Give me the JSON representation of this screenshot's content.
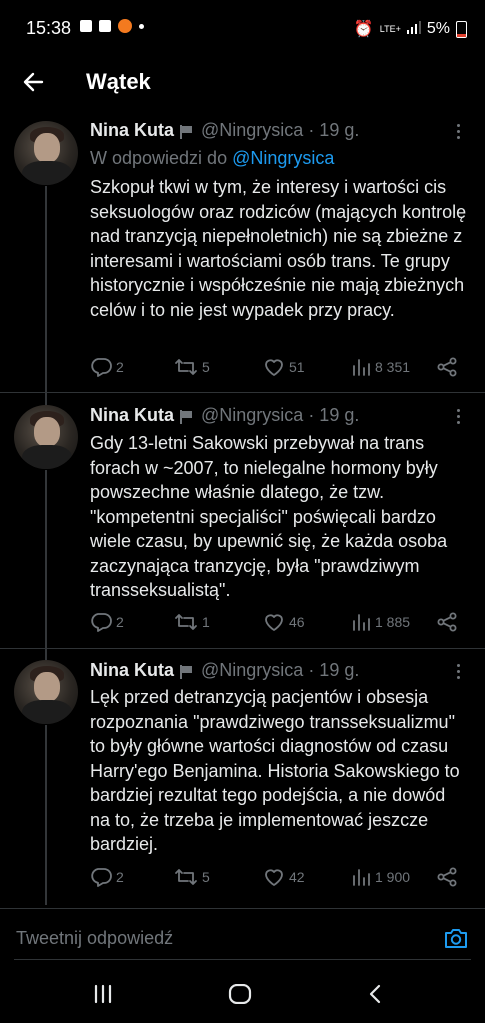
{
  "status": {
    "time": "15:38",
    "network": "LTE+",
    "battery": "5%"
  },
  "header": {
    "title": "Wątek"
  },
  "tweets": [
    {
      "name": "Nina Kuta",
      "handle": "@Ningrysica · 19 g.",
      "reply_prefix": "W odpowiedzi do",
      "reply_mention": "@Ningrysica",
      "text": "Szkopuł tkwi w tym, że interesy i wartości cis seksuologów oraz rodziców (mających kontrolę nad tranzycją niepełnoletnich) nie są zbieżne z interesami i wartościami osób trans. Te grupy historycznie i współcześnie nie mają zbieżnych celów i to nie jest wypadek przy pracy.",
      "replies": "2",
      "retweets": "5",
      "likes": "51",
      "views": "8 351"
    },
    {
      "name": "Nina Kuta",
      "handle": "@Ningrysica · 19 g.",
      "text": "Gdy 13-letni Sakowski przebywał na trans forach w ~2007, to nielegalne hormony były powszechne właśnie dlatego, że tzw. \"kompetentni specjaliści\" poświęcali bardzo wiele czasu, by upewnić się, że każda osoba zaczynająca tranzycję, była \"prawdziwym transseksualistą\".",
      "replies": "2",
      "retweets": "1",
      "likes": "46",
      "views": "1 885"
    },
    {
      "name": "Nina Kuta",
      "handle": "@Ningrysica · 19 g.",
      "text": "Lęk przed detranzycją pacjentów i obsesja rozpoznania \"prawdziwego transseksualizmu\" to były główne wartości diagnostów od czasu Harry'ego Benjamina. Historia Sakowskiego to bardziej rezultat tego podejścia, a nie dowód na to, że trzeba je implementować jeszcze bardziej.",
      "replies": "2",
      "retweets": "5",
      "likes": "42",
      "views": "1 900"
    }
  ],
  "reply": {
    "placeholder": "Tweetnij odpowiedź"
  },
  "colors": {
    "background": "#000000",
    "text": "#e7e9ea",
    "muted": "#71767b",
    "accent": "#1d9bf0"
  },
  "icons": [
    "back-arrow-icon",
    "flag-icon",
    "more-icon",
    "reply-icon",
    "retweet-icon",
    "like-icon",
    "views-icon",
    "share-icon",
    "camera-icon",
    "recents-icon",
    "home-icon",
    "back-icon"
  ]
}
